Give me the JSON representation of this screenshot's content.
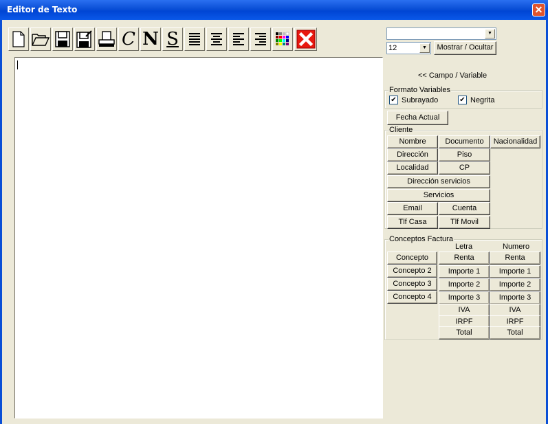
{
  "window": {
    "title": "Editor de Texto"
  },
  "toolbar": {
    "buttons": [
      {
        "name": "new-file-icon"
      },
      {
        "name": "open-folder-icon"
      },
      {
        "name": "save-icon"
      },
      {
        "name": "save-as-icon"
      },
      {
        "name": "print-icon"
      },
      {
        "name": "italic-icon",
        "glyph": "C"
      },
      {
        "name": "bold-icon",
        "glyph": "N"
      },
      {
        "name": "underline-icon",
        "glyph": "S"
      },
      {
        "name": "justify-icon"
      },
      {
        "name": "align-center-icon"
      },
      {
        "name": "align-left-icon"
      },
      {
        "name": "align-right-icon"
      },
      {
        "name": "color-palette-icon"
      },
      {
        "name": "delete-icon"
      }
    ]
  },
  "font": {
    "name_value": "",
    "size_value": "12"
  },
  "buttons": {
    "toggle": "Mostrar / Ocultar",
    "campo_variable": "<< Campo / Variable",
    "fecha_actual": "Fecha Actual"
  },
  "formato": {
    "title": "Formato Variables",
    "underline_label": "Subrayado",
    "bold_label": "Negrita",
    "checkmark": "✔"
  },
  "cliente": {
    "title": "Cliente",
    "nombre": "Nombre",
    "documento": "Documento",
    "nacionalidad": "Nacionalidad",
    "direccion": "Dirección",
    "piso": "Piso",
    "localidad": "Localidad",
    "cp": "CP",
    "direccion_servicios": "Dirección servicios",
    "servicios": "Servicios",
    "email": "Email",
    "cuenta": "Cuenta",
    "tlf_casa": "Tlf Casa",
    "tlf_movil": "Tlf Movil"
  },
  "conceptos": {
    "title": "Conceptos Factura",
    "col_letra": "Letra",
    "col_numero": "Numero",
    "concepto": "Concepto",
    "concepto2": "Concepto 2",
    "concepto3": "Concepto 3",
    "concepto4": "Concepto 4",
    "renta": "Renta",
    "importe1": "Importe 1",
    "importe2": "Importe 2",
    "importe3": "Importe 3",
    "iva": "IVA",
    "irpf": "IRPF",
    "total": "Total"
  },
  "colors": {
    "title_bar": "#0a4fd6",
    "close": "#e0542d",
    "face": "#ece9d8"
  }
}
